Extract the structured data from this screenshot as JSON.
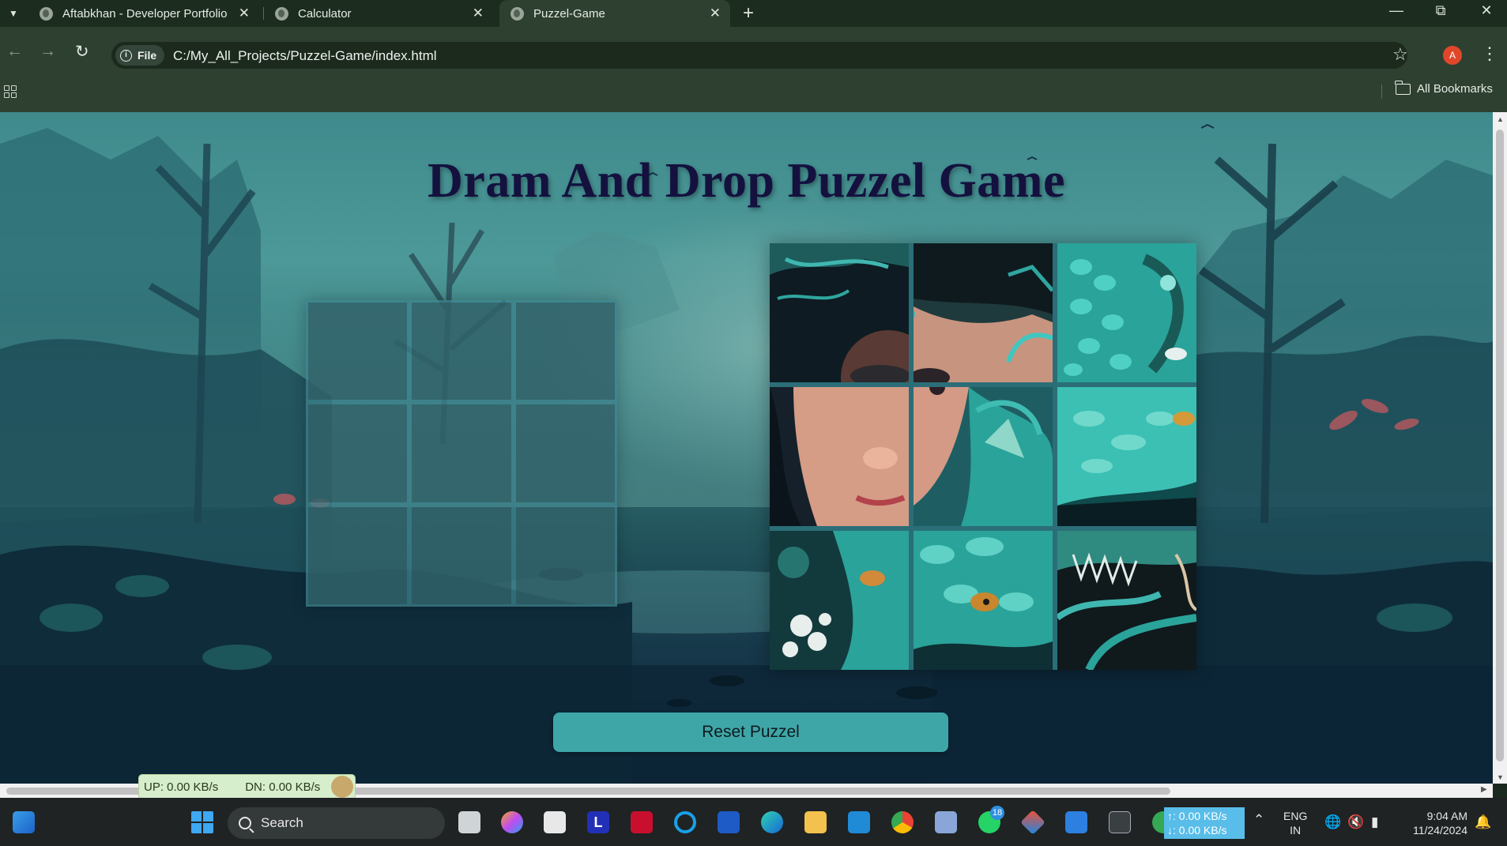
{
  "browser": {
    "tabs": [
      {
        "title": "Aftabkhan - Developer Portfolio",
        "active": false
      },
      {
        "title": "Calculator",
        "active": false
      },
      {
        "title": "Puzzel-Game",
        "active": true
      }
    ],
    "new_tab": "+",
    "security_chip": "File",
    "url": "C:/My_All_Projects/Puzzel-Game/index.html",
    "profile_initial": "A",
    "bookmarks_label": "All Bookmarks"
  },
  "page": {
    "title": "Dram And Drop Puzzel Game",
    "reset_label": "Reset Puzzel",
    "board_slots": 9,
    "pieces": [
      {
        "id": "piece-1",
        "image_part": "girl-top-left"
      },
      {
        "id": "piece-2",
        "image_part": "girl-forehead-jewel"
      },
      {
        "id": "piece-3",
        "image_part": "dragon-scales-top-right"
      },
      {
        "id": "piece-4",
        "image_part": "girl-face"
      },
      {
        "id": "piece-5",
        "image_part": "girl-eye-dragon-claw"
      },
      {
        "id": "piece-6",
        "image_part": "dragon-head-eye"
      },
      {
        "id": "piece-7",
        "image_part": "dragon-flowers-bottom-left"
      },
      {
        "id": "piece-8",
        "image_part": "dragon-eye-bottom"
      },
      {
        "id": "piece-9",
        "image_part": "dragon-teeth-bottom-right"
      }
    ]
  },
  "net_meter": {
    "up": "UP: 0.00 KB/s",
    "down": "DN: 0.00 KB/s"
  },
  "taskbar": {
    "search_label": "Search",
    "whatsapp_badge": "18",
    "tray_up": "↑: 0.00 KB/s",
    "tray_down": "↓: 0.00 KB/s",
    "lang_line1": "ENG",
    "lang_line2": "IN",
    "time": "9:04 AM",
    "date": "11/24/2024"
  },
  "colors": {
    "title": "#14113f",
    "reset_button": "#3fa6a8",
    "browser_frame": "#2e4030"
  }
}
